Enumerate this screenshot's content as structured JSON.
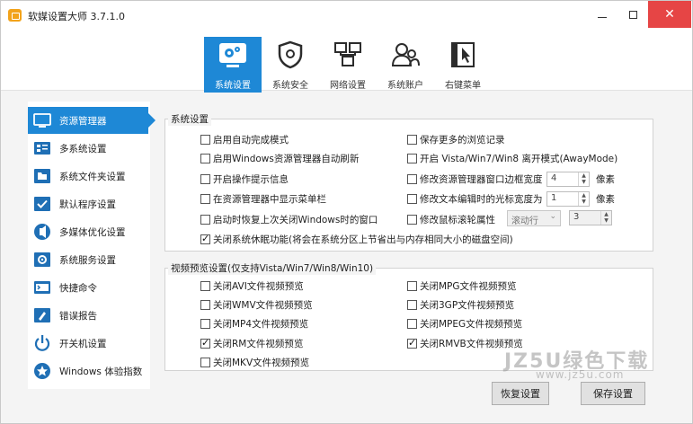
{
  "app": {
    "title": "软媒设置大师 3.7.1.0"
  },
  "window_controls": {
    "minimize": "—",
    "close": "✕"
  },
  "tabs": [
    {
      "label": "系统设置",
      "icon": "settings-gear-icon",
      "active": true
    },
    {
      "label": "系统安全",
      "icon": "shield-icon",
      "active": false
    },
    {
      "label": "网络设置",
      "icon": "network-icon",
      "active": false
    },
    {
      "label": "系统账户",
      "icon": "users-icon",
      "active": false
    },
    {
      "label": "右键菜单",
      "icon": "cursor-menu-icon",
      "active": false
    }
  ],
  "sidebar": {
    "items": [
      {
        "label": "资源管理器",
        "icon": "explorer-icon",
        "active": true
      },
      {
        "label": "多系统设置",
        "icon": "multi-os-icon",
        "active": false
      },
      {
        "label": "系统文件夹设置",
        "icon": "folder-icon",
        "active": false
      },
      {
        "label": "默认程序设置",
        "icon": "default-program-icon",
        "active": false
      },
      {
        "label": "多媒体优化设置",
        "icon": "multimedia-icon",
        "active": false
      },
      {
        "label": "系统服务设置",
        "icon": "service-icon",
        "active": false
      },
      {
        "label": "快捷命令",
        "icon": "command-icon",
        "active": false
      },
      {
        "label": "错误报告",
        "icon": "error-report-icon",
        "active": false
      },
      {
        "label": "开关机设置",
        "icon": "power-icon",
        "active": false
      },
      {
        "label": "Windows 体验指数",
        "icon": "experience-index-icon",
        "active": false
      }
    ]
  },
  "system_group": {
    "title": "系统设置",
    "options": [
      {
        "label": "启用自动完成模式",
        "checked": false
      },
      {
        "label": "保存更多的浏览记录",
        "checked": false
      },
      {
        "label": "启用Windows资源管理器自动刷新",
        "checked": false
      },
      {
        "label": "开启 Vista/Win7/Win8 离开模式(AwayMode)",
        "checked": false
      },
      {
        "label": "开启操作提示信息",
        "checked": false
      },
      {
        "label": "修改资源管理器窗口边框宽度",
        "checked": false
      },
      {
        "label": "在资源管理器中显示菜单栏",
        "checked": false
      },
      {
        "label": "修改文本编辑时的光标宽度为",
        "checked": false
      },
      {
        "label": "启动时恢复上次关闭Windows时的窗口",
        "checked": false
      },
      {
        "label": "修改鼠标滚轮属性",
        "checked": false
      },
      {
        "label": "关闭系统休眠功能(将会在系统分区上节省出与内存相同大小的磁盘空间)",
        "checked": true
      }
    ],
    "border_width": {
      "value": "4",
      "unit": "像素"
    },
    "cursor_width": {
      "value": "1",
      "unit": "像素"
    },
    "wheel_mode": {
      "value": "滚动行"
    },
    "wheel_lines": {
      "value": "3"
    }
  },
  "video_group": {
    "title": "视频预览设置(仅支持Vista/Win7/Win8/Win10)",
    "options": [
      {
        "label": "关闭AVI文件视频预览",
        "checked": false
      },
      {
        "label": "关闭MPG文件视频预览",
        "checked": false
      },
      {
        "label": "关闭WMV文件视频预览",
        "checked": false
      },
      {
        "label": "关闭3GP文件视频预览",
        "checked": false
      },
      {
        "label": "关闭MP4文件视频预览",
        "checked": false
      },
      {
        "label": "关闭MPEG文件视频预览",
        "checked": false
      },
      {
        "label": "关闭RM文件视频预览",
        "checked": true
      },
      {
        "label": "关闭RMVB文件视频预览",
        "checked": true
      },
      {
        "label": "关闭MKV文件视频预览",
        "checked": false
      }
    ]
  },
  "buttons": {
    "restore": "恢复设置",
    "save": "保存设置"
  },
  "watermark": {
    "line1": "JZ5U绿色下载",
    "line2": "www.jz5u.com"
  },
  "colors": {
    "accent": "#1e88d6",
    "close": "#e64545",
    "icon_blue": "#1f6fb5"
  }
}
